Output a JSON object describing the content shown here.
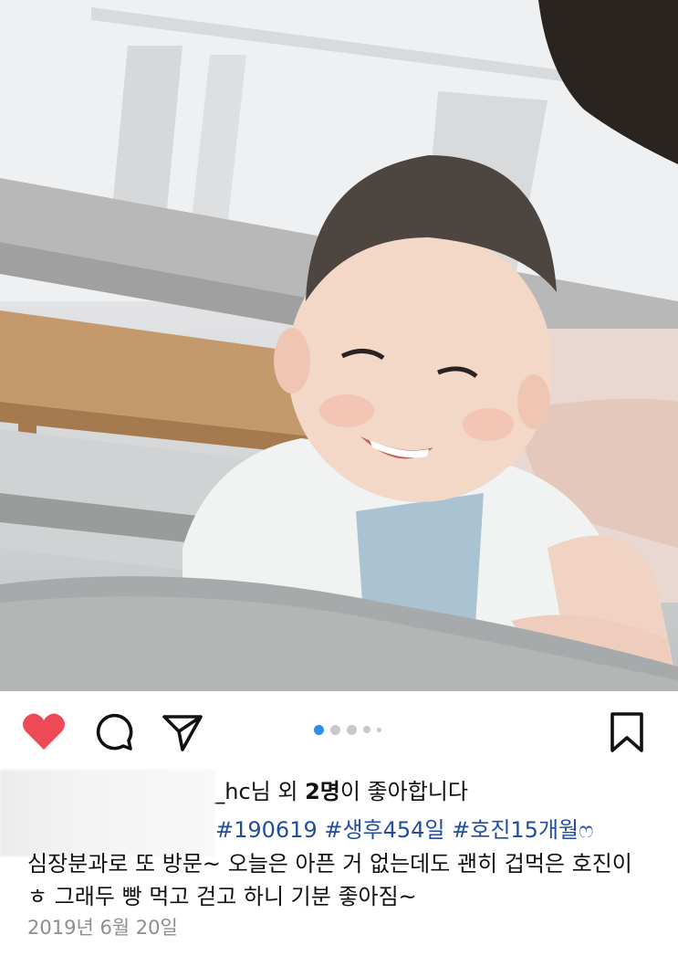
{
  "post": {
    "photo_description_icon": "photo",
    "carousel": {
      "total": 5,
      "active_index": 0
    },
    "actions": {
      "like_icon": "heart-filled-icon",
      "like_color": "#ed4956",
      "comment_icon": "comment-icon",
      "share_icon": "send-icon",
      "save_icon": "bookmark-icon"
    },
    "likes": {
      "username_fragment": "g_hc",
      "suffix_1": "님 외 ",
      "count": "2명",
      "suffix_2": "이 좋아합니다"
    },
    "hashtags": "#190619 #생후454일 #호진15개월ෆ",
    "caption_line1": "심장분과로 또 방문~ 오늘은 아픈 거 없는데도 괜히 겁먹은 호진이",
    "caption_line2": "ㅎ 그래두 빵 먹고 걷고 하니 기분 좋아짐~",
    "date": "2019년 6월 20일",
    "hashtag_color": "#234e9c",
    "carousel_active_color": "#2d8cf0"
  }
}
